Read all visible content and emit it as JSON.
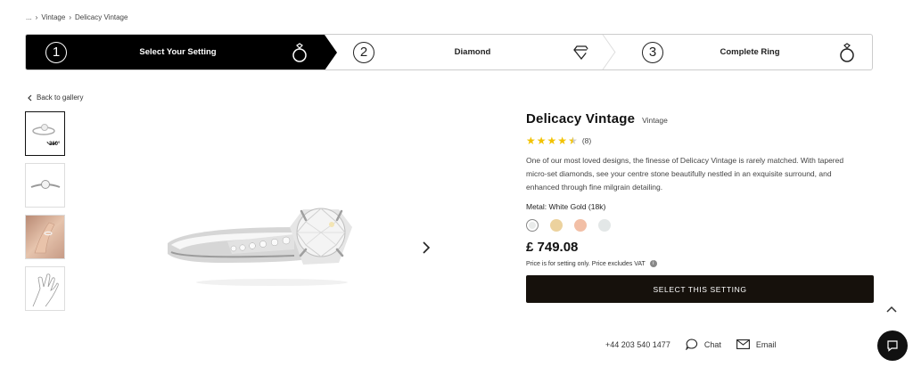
{
  "breadcrumb": {
    "ellipsis": "...",
    "sep1": "›",
    "item1": "Vintage",
    "sep2": "›",
    "item2": "Delicacy Vintage"
  },
  "steps": [
    {
      "num": "1",
      "label": "Select Your Setting",
      "icon": "ring-icon"
    },
    {
      "num": "2",
      "label": "Diamond",
      "icon": "diamond-icon"
    },
    {
      "num": "3",
      "label": "Complete Ring",
      "icon": "ring-icon"
    }
  ],
  "back_label": "Back to gallery",
  "thumbs": [
    {
      "kind": "ring-top",
      "badge": "360°"
    },
    {
      "kind": "ring-front"
    },
    {
      "kind": "hand-photo"
    },
    {
      "kind": "hand-sketch"
    }
  ],
  "product": {
    "name": "Delicacy Vintage",
    "collection": "Vintage",
    "rating_stars": 4.5,
    "review_count": "(8)",
    "description": "One of our most loved designs, the finesse of Delicacy Vintage is rarely matched. With tapered micro-set diamonds, see your centre stone beautifully nestled in an exquisite surround, and enhanced through fine milgrain detailing.",
    "metal_label": "Metal: White Gold (18k)",
    "swatches": [
      "#e9ebea",
      "#ecd29e",
      "#f2bfa6",
      "#e3e7e7"
    ],
    "price": "£ 749.08",
    "price_note": "Price is for setting only. Price excludes VAT",
    "info_glyph": "i",
    "cta": "SELECT THIS SETTING"
  },
  "contact": {
    "phone": "+44 203 540 1477",
    "chat": "Chat",
    "email": "Email"
  }
}
